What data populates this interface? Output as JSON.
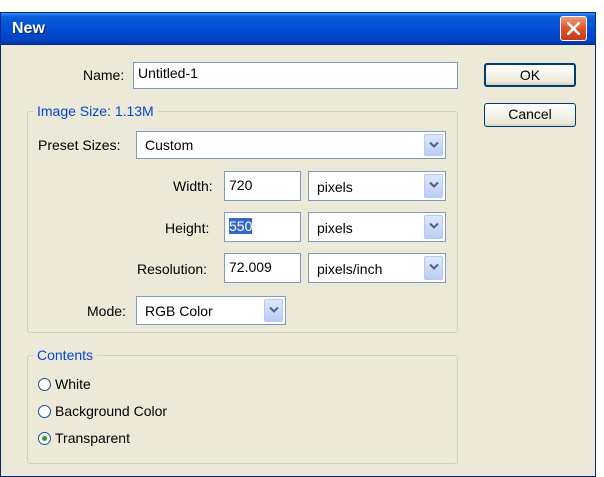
{
  "dialog": {
    "title": "New",
    "name_label": "Name:",
    "name_value": "Untitled-1",
    "ok_label": "OK",
    "cancel_label": "Cancel"
  },
  "image_size": {
    "legend": "Image Size: 1.13M",
    "preset_label": "Preset Sizes:",
    "preset_value": "Custom",
    "width_label": "Width:",
    "width_value": "720",
    "width_unit": "pixels",
    "height_label": "Height:",
    "height_value": "550",
    "height_unit": "pixels",
    "resolution_label": "Resolution:",
    "resolution_value": "72.009",
    "resolution_unit": "pixels/inch",
    "mode_label": "Mode:",
    "mode_value": "RGB Color"
  },
  "contents": {
    "legend": "Contents",
    "options": [
      {
        "label": "White",
        "selected": false
      },
      {
        "label": "Background Color",
        "selected": false
      },
      {
        "label": "Transparent",
        "selected": true
      }
    ]
  },
  "colors": {
    "title_bar": "#0350d6",
    "legend_text": "#0046d5",
    "selection": "#316ac5"
  }
}
